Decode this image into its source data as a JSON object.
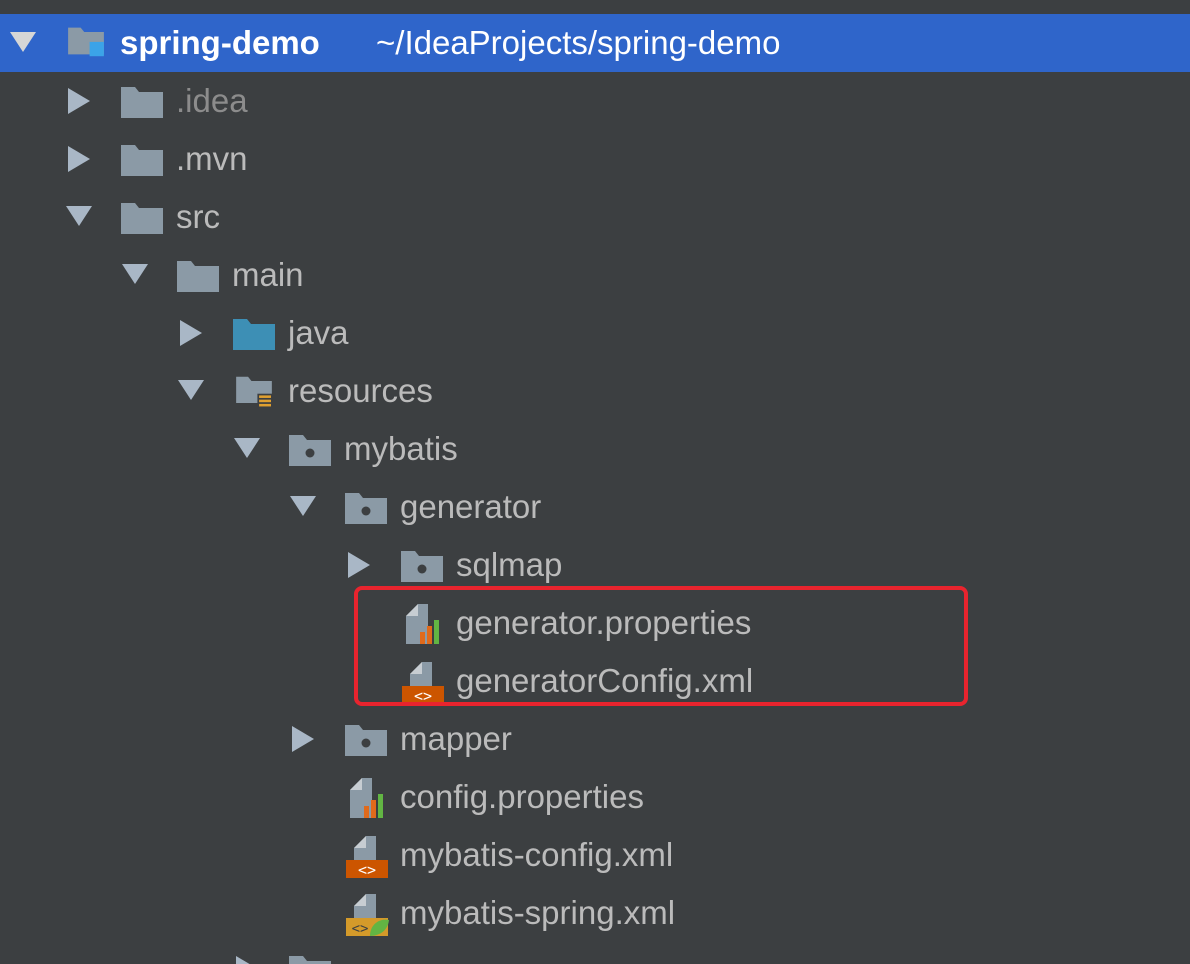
{
  "project": {
    "name": "spring-demo",
    "path": "~/IdeaProjects/spring-demo"
  },
  "tree": {
    "idea": ".idea",
    "mvn": ".mvn",
    "src": "src",
    "main": "main",
    "java": "java",
    "resources": "resources",
    "mybatis": "mybatis",
    "generator": "generator",
    "sqlmap": "sqlmap",
    "generator_properties": "generator.properties",
    "generator_config": "generatorConfig.xml",
    "mapper": "mapper",
    "config_properties": "config.properties",
    "mybatis_config": "mybatis-config.xml",
    "mybatis_spring": "mybatis-spring.xml"
  },
  "colors": {
    "selection": "#2f65ca",
    "highlight_border": "#e8242e",
    "folder": "#8b9aa6",
    "source_folder": "#3d8fb5"
  }
}
